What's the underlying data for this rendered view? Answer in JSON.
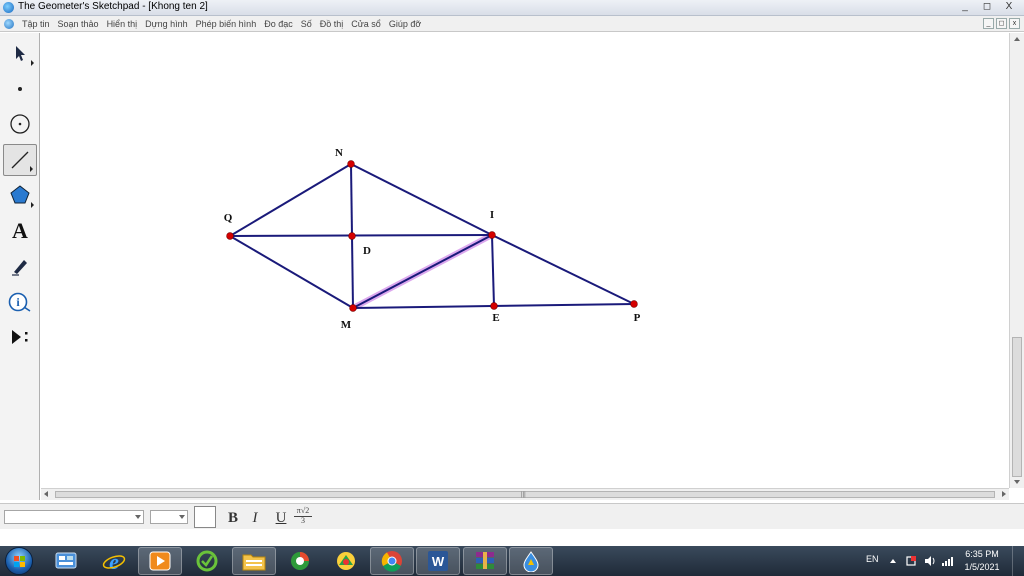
{
  "window": {
    "title": "The Geometer's Sketchpad - [Khong ten 2]",
    "controls": [
      "_",
      "◻",
      "X"
    ]
  },
  "menu": {
    "items": [
      "Tập tin",
      "Soạn thảo",
      "Hiển thị",
      "Dựng hình",
      "Phép biến hình",
      "Đo đạc",
      "Số",
      "Đồ thị",
      "Cửa sổ",
      "Giúp đỡ"
    ],
    "doc_controls": [
      "_",
      "◻",
      "x"
    ]
  },
  "toolbox": {
    "tools": [
      "arrow-tool",
      "point-tool",
      "compass-tool",
      "straightedge-tool",
      "polygon-tool",
      "text-tool",
      "marker-tool",
      "information-tool",
      "custom-tool"
    ],
    "selected": "straightedge-tool",
    "text_tool_glyph": "A"
  },
  "sketch": {
    "line_color": "#1a1a7a",
    "point_color": "#d40000",
    "highlight_color": "#c060e0",
    "point_labels": [
      "N",
      "Q",
      "I",
      "D",
      "M",
      "E",
      "P"
    ],
    "segments": [
      "QN",
      "NI",
      "IP",
      "QM",
      "MP",
      "QI",
      "NM",
      "IE",
      "MI"
    ],
    "highlighted_segment": "MI"
  },
  "text_palette": {
    "bold": "B",
    "italic": "I",
    "underline": "U",
    "symbol_top": "π√2",
    "symbol_bottom": "3"
  },
  "taskbar": {
    "apps": [
      "start",
      "control-panel",
      "internet-explorer",
      "media-player",
      "beta-app",
      "file-explorer",
      "coccoc-browser",
      "sketchpad",
      "chrome",
      "word",
      "winrar",
      "sketchpad-2"
    ],
    "language": "EN",
    "time": "6:35 PM",
    "date": "1/5/2021"
  }
}
